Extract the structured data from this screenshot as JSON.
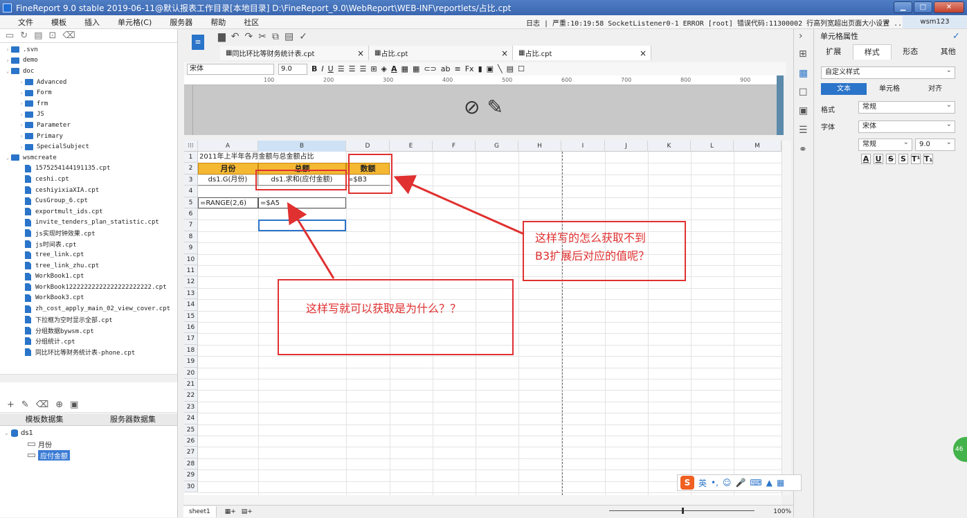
{
  "window": {
    "title": "FineReport 9.0 stable 2019-06-11@默认报表工作目录[本地目录]    D:\\FineReport_9.0\\WebReport\\WEB-INF\\reportlets/占比.cpt"
  },
  "menu": [
    "文件",
    "模板",
    "插入",
    "单元格(C)",
    "服务器",
    "帮助",
    "社区"
  ],
  "status_message": "日志 | 严重:10:19:58 SocketListener0-1 ERROR [root] 错误代码:11300002 行高列宽超出页面大小设置 ...",
  "user": "wsm123",
  "tree": [
    {
      "label": ".svn",
      "type": "folder",
      "depth": 0,
      "arrow": "›"
    },
    {
      "label": "demo",
      "type": "folder",
      "depth": 0,
      "arrow": "›"
    },
    {
      "label": "doc",
      "type": "folder",
      "depth": 0,
      "arrow": "⌄"
    },
    {
      "label": "Advanced",
      "type": "folder",
      "depth": 1,
      "arrow": "›"
    },
    {
      "label": "Form",
      "type": "folder",
      "depth": 1,
      "arrow": "›"
    },
    {
      "label": "frm",
      "type": "folder",
      "depth": 1,
      "arrow": "›"
    },
    {
      "label": "JS",
      "type": "folder",
      "depth": 1,
      "arrow": "›"
    },
    {
      "label": "Parameter",
      "type": "folder",
      "depth": 1,
      "arrow": "›"
    },
    {
      "label": "Primary",
      "type": "folder",
      "depth": 1,
      "arrow": "›"
    },
    {
      "label": "SpecialSubject",
      "type": "folder",
      "depth": 1,
      "arrow": "›"
    },
    {
      "label": "wsmcreate",
      "type": "folder",
      "depth": 0,
      "arrow": "⌄"
    },
    {
      "label": "1575254144191135.cpt",
      "type": "file",
      "depth": 1,
      "arrow": ""
    },
    {
      "label": "ceshi.cpt",
      "type": "file",
      "depth": 1,
      "arrow": ""
    },
    {
      "label": "ceshiyixiaXIA.cpt",
      "type": "file",
      "depth": 1,
      "arrow": ""
    },
    {
      "label": "CusGroup_6.cpt",
      "type": "file",
      "depth": 1,
      "arrow": ""
    },
    {
      "label": "exportmult_ids.cpt",
      "type": "file",
      "depth": 1,
      "arrow": ""
    },
    {
      "label": "invite_tenders_plan_statistic.cpt",
      "type": "file",
      "depth": 1,
      "arrow": ""
    },
    {
      "label": "js实现时钟效果.cpt",
      "type": "file",
      "depth": 1,
      "arrow": ""
    },
    {
      "label": "js时间表.cpt",
      "type": "file",
      "depth": 1,
      "arrow": ""
    },
    {
      "label": "tree_link.cpt",
      "type": "file",
      "depth": 1,
      "arrow": ""
    },
    {
      "label": "tree_link_zhu.cpt",
      "type": "file",
      "depth": 1,
      "arrow": ""
    },
    {
      "label": "WorkBook1.cpt",
      "type": "file",
      "depth": 1,
      "arrow": ""
    },
    {
      "label": "WorkBook12222222222222222222222.cpt",
      "type": "file",
      "depth": 1,
      "arrow": ""
    },
    {
      "label": "WorkBook3.cpt",
      "type": "file",
      "depth": 1,
      "arrow": ""
    },
    {
      "label": "zh_cost_apply_main_02_view_cover.cpt",
      "type": "file",
      "depth": 1,
      "arrow": ""
    },
    {
      "label": "下拉框为空时显示全部.cpt",
      "type": "file",
      "depth": 1,
      "arrow": ""
    },
    {
      "label": "分组数据bywsm.cpt",
      "type": "file",
      "depth": 1,
      "arrow": ""
    },
    {
      "label": "分组统计.cpt",
      "type": "file",
      "depth": 1,
      "arrow": ""
    },
    {
      "label": "同比环比等财务统计表-phone.cpt",
      "type": "file",
      "depth": 1,
      "arrow": ""
    }
  ],
  "dataset_tabs": [
    "模板数据集",
    "服务器数据集"
  ],
  "datasets": {
    "name": "ds1",
    "fields": [
      "月份",
      "应付金额"
    ],
    "selected": "应付金额"
  },
  "tabs": [
    {
      "label": "同比环比等财务统计表.cpt"
    },
    {
      "label": "占比.cpt"
    },
    {
      "label": "占比.cpt",
      "active": true
    }
  ],
  "format_toolbar": {
    "font": "宋体",
    "size": "9.0"
  },
  "ruler": [
    "100",
    "200",
    "300",
    "400",
    "500",
    "600",
    "700",
    "800",
    "900"
  ],
  "columns": [
    "A",
    "B",
    "D",
    "E",
    "F",
    "G",
    "H",
    "I",
    "J",
    "K",
    "L",
    "M"
  ],
  "rows": [
    "1",
    "2",
    "3",
    "4",
    "5",
    "6",
    "7",
    "8",
    "9",
    "10",
    "11",
    "12",
    "13",
    "14",
    "15",
    "16",
    "17",
    "18",
    "19",
    "20",
    "21",
    "22",
    "23",
    "24",
    "25",
    "26",
    "27",
    "28",
    "29",
    "30"
  ],
  "cells": {
    "title": "2011年上半年各月金额与总金额占比",
    "hdr_month": "月份",
    "hdr_total": "总额",
    "hdr_amount": "数额",
    "a3": "ds1.G(月份)",
    "b3": "ds1.求和(应付金额)",
    "d3": "=$B3",
    "a5": "=RANGE(2,6)",
    "b5": "=$A5"
  },
  "annotations": {
    "right_text_1": "这样写的怎么获取不到",
    "right_text_2": "B3扩展后对应的值呢？",
    "left_text": "这样写就可以获取是为什么？？"
  },
  "sheet_tab": "sheet1",
  "zoom": "100%",
  "right_panel": {
    "title": "单元格属性",
    "tabs": [
      "扩展",
      "样式",
      "形态",
      "其他"
    ],
    "style_select": "自定义样式",
    "subtabs": [
      "文本",
      "单元格",
      "对齐"
    ],
    "format_label": "格式",
    "format_value": "常规",
    "font_label": "字体",
    "font_value": "宋体",
    "font_style": "常规",
    "font_size": "9.0"
  },
  "ime": {
    "lang": "英"
  },
  "badge": "46"
}
